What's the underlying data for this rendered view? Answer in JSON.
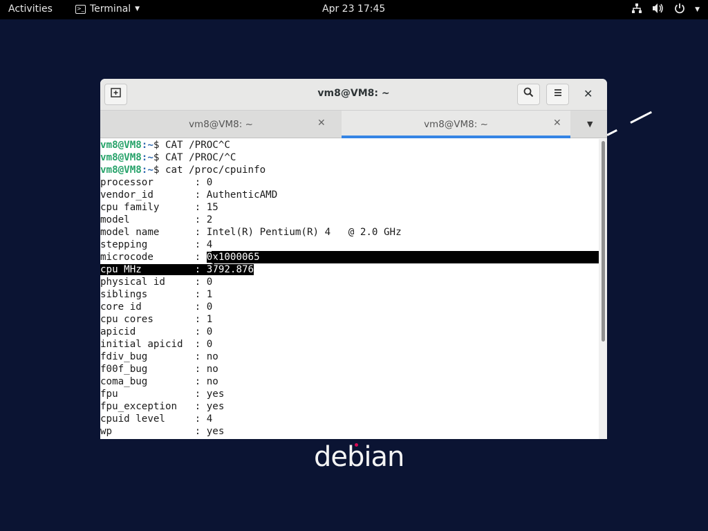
{
  "topbar": {
    "activities": "Activities",
    "app_name": "Terminal",
    "clock": "Apr 23  17:45",
    "tray_icons": [
      "network-icon",
      "volume-icon",
      "power-icon"
    ]
  },
  "window": {
    "title": "vm8@VM8: ~",
    "tabs": [
      {
        "label": "vm8@VM8: ~",
        "active": false
      },
      {
        "label": "vm8@VM8: ~",
        "active": true
      }
    ]
  },
  "terminal": {
    "prompts": [
      {
        "user": "vm8@VM8",
        "path": ":~",
        "command": "$ CAT /PROC^C"
      },
      {
        "user": "vm8@VM8",
        "path": ":~",
        "command": "$ CAT /PROC/^C"
      },
      {
        "user": "vm8@VM8",
        "path": ":~",
        "command": "$ cat /proc/cpuinfo"
      }
    ],
    "lines": [
      {
        "key": "processor       ",
        "value": "0"
      },
      {
        "key": "vendor_id       ",
        "value": "AuthenticAMD"
      },
      {
        "key": "cpu family      ",
        "value": "15"
      },
      {
        "key": "model           ",
        "value": "2"
      },
      {
        "key": "model name      ",
        "value": "Intel(R) Pentium(R) 4   @ 2.0 GHz"
      },
      {
        "key": "stepping        ",
        "value": "4"
      },
      {
        "key": "microcode       ",
        "value": "0x1000065"
      },
      {
        "key": "cpu MHz         ",
        "value": "3792.876"
      },
      {
        "key": "physical id     ",
        "value": "0"
      },
      {
        "key": "siblings        ",
        "value": "1"
      },
      {
        "key": "core id         ",
        "value": "0"
      },
      {
        "key": "cpu cores       ",
        "value": "1"
      },
      {
        "key": "apicid          ",
        "value": "0"
      },
      {
        "key": "initial apicid  ",
        "value": "0"
      },
      {
        "key": "fdiv_bug        ",
        "value": "no"
      },
      {
        "key": "f00f_bug        ",
        "value": "no"
      },
      {
        "key": "coma_bug        ",
        "value": "no"
      },
      {
        "key": "fpu             ",
        "value": "yes"
      },
      {
        "key": "fpu_exception   ",
        "value": "yes"
      },
      {
        "key": "cpuid level     ",
        "value": "4"
      },
      {
        "key": "wp              ",
        "value": "yes"
      }
    ],
    "separator": ": "
  },
  "desktop": {
    "logo_text": "debian"
  },
  "colors": {
    "prompt_user": "#26a269",
    "prompt_path": "#2f6ab0",
    "tab_active_underline": "#3584e4",
    "desktop_bg": "#0b1433"
  }
}
